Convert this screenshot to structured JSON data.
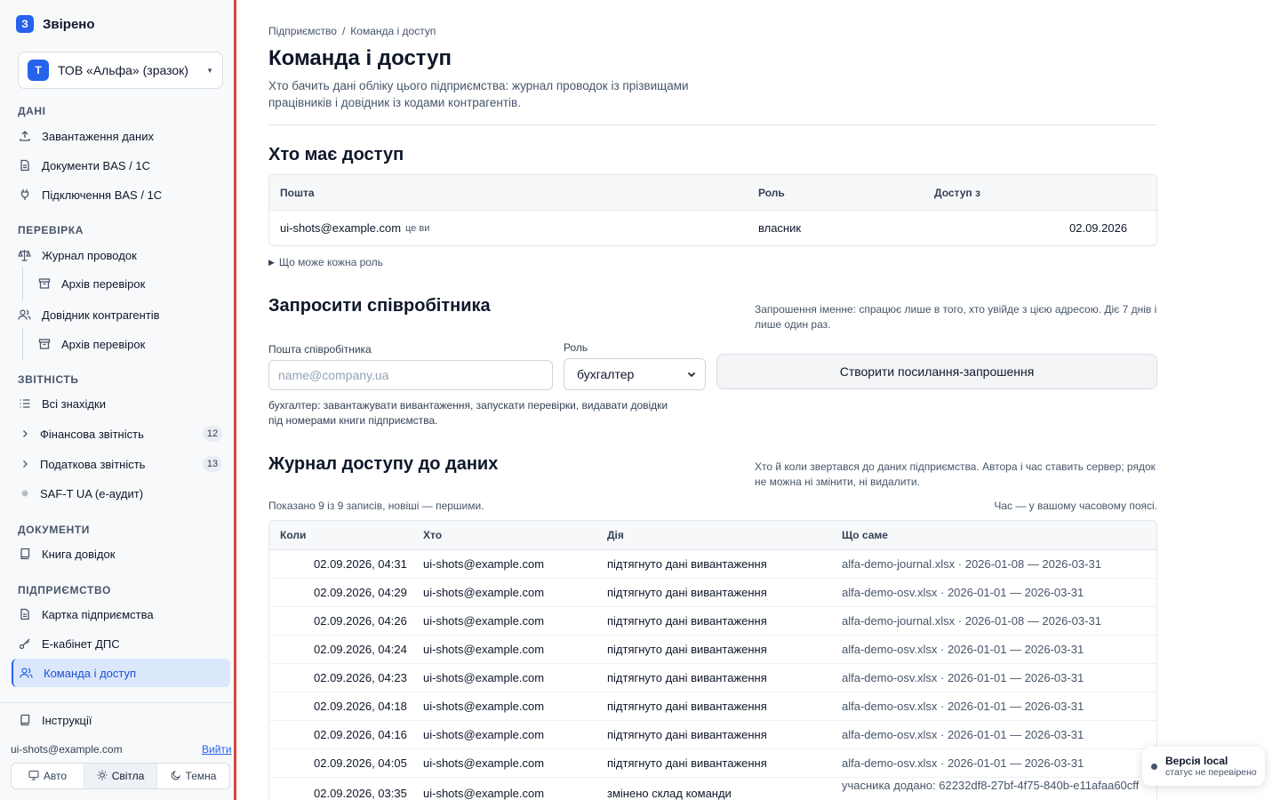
{
  "app": {
    "logo_letter": "З",
    "name": "Звірено"
  },
  "org": {
    "avatar_letter": "Т",
    "name": "ТОВ «Альфа» (зразок)"
  },
  "sidebar": {
    "sections": {
      "data": "ДАНІ",
      "check": "ПЕРЕВІРКА",
      "reports": "ЗВІТНІСТЬ",
      "documents": "ДОКУМЕНТИ",
      "company": "ПІДПРИЄМСТВО"
    },
    "items": {
      "upload": "Завантаження даних",
      "bas_docs": "Документи BAS / 1С",
      "bas_connect": "Підключення BAS / 1С",
      "journal": "Журнал проводок",
      "journal_archive": "Архів перевірок",
      "counterparties": "Довідник контрагентів",
      "counterparties_archive": "Архів перевірок",
      "all_findings": "Всі знахідки",
      "financial": "Фінансова звітність",
      "financial_count": "12",
      "tax": "Податкова звітність",
      "tax_count": "13",
      "saft": "SAF-T UA (е-аудит)",
      "certificates_book": "Книга довідок",
      "company_card": "Картка підприємства",
      "dps_cabinet": "Е-кабінет ДПС",
      "team_access": "Команда і доступ",
      "instructions": "Інструкції"
    },
    "user_email": "ui-shots@example.com",
    "logout": "Вийти",
    "theme": {
      "auto": "Авто",
      "light": "Світла",
      "dark": "Темна",
      "selected": "light"
    }
  },
  "breadcrumb": {
    "parent": "Підприємство",
    "sep": "/",
    "current": "Команда і доступ"
  },
  "page": {
    "title": "Команда і доступ",
    "subtitle": "Хто бачить дані обліку цього підприємства: журнал проводок із прізвищами працівників і довідник із кодами контрагентів."
  },
  "access": {
    "title": "Хто має доступ",
    "columns": {
      "email": "Пошта",
      "role": "Роль",
      "since": "Доступ з"
    },
    "rows": [
      {
        "email": "ui-shots@example.com",
        "tag": "це ви",
        "role": "власник",
        "since": "02.09.2026"
      }
    ],
    "roles_toggle": "Що може кожна роль"
  },
  "invite": {
    "title": "Запросити співробітника",
    "note": "Запрошення іменне: спрацює лише в того, хто увійде з цією адресою. Діє 7 днів і лише один раз.",
    "email_label": "Пошта співробітника",
    "email_placeholder": "name@company.ua",
    "email_value": "",
    "role_label": "Роль",
    "role_value": "бухгалтер",
    "submit": "Створити посилання-запрошення",
    "role_help": "бухгалтер: завантажувати вивантаження, запускати перевірки, видавати довідки під номерами книги підприємства."
  },
  "log": {
    "title": "Журнал доступу до даних",
    "note": "Хто й коли звертався до даних підприємства. Автора і час ставить сервер; рядок не можна ні змінити, ні видалити.",
    "shown": "Показано 9 із 9 записів, новіші — першими.",
    "tz_note": "Час — у вашому часовому поясі.",
    "columns": {
      "when": "Коли",
      "who": "Хто",
      "action": "Дія",
      "what": "Що саме"
    },
    "rows": [
      {
        "when": "02.09.2026, 04:31",
        "who": "ui-shots@example.com",
        "action": "підтягнуто дані вивантаження",
        "what": "alfa-demo-journal.xlsx · 2026-01-08 — 2026-03-31"
      },
      {
        "when": "02.09.2026, 04:29",
        "who": "ui-shots@example.com",
        "action": "підтягнуто дані вивантаження",
        "what": "alfa-demo-osv.xlsx · 2026-01-01 — 2026-03-31"
      },
      {
        "when": "02.09.2026, 04:26",
        "who": "ui-shots@example.com",
        "action": "підтягнуто дані вивантаження",
        "what": "alfa-demo-journal.xlsx · 2026-01-08 — 2026-03-31"
      },
      {
        "when": "02.09.2026, 04:24",
        "who": "ui-shots@example.com",
        "action": "підтягнуто дані вивантаження",
        "what": "alfa-demo-osv.xlsx · 2026-01-01 — 2026-03-31"
      },
      {
        "when": "02.09.2026, 04:23",
        "who": "ui-shots@example.com",
        "action": "підтягнуто дані вивантаження",
        "what": "alfa-demo-osv.xlsx · 2026-01-01 — 2026-03-31"
      },
      {
        "when": "02.09.2026, 04:18",
        "who": "ui-shots@example.com",
        "action": "підтягнуто дані вивантаження",
        "what": "alfa-demo-osv.xlsx · 2026-01-01 — 2026-03-31"
      },
      {
        "when": "02.09.2026, 04:16",
        "who": "ui-shots@example.com",
        "action": "підтягнуто дані вивантаження",
        "what": "alfa-demo-osv.xlsx · 2026-01-01 — 2026-03-31"
      },
      {
        "when": "02.09.2026, 04:05",
        "who": "ui-shots@example.com",
        "action": "підтягнуто дані вивантаження",
        "what": "alfa-demo-osv.xlsx · 2026-01-01 — 2026-03-31"
      },
      {
        "when": "02.09.2026, 03:35",
        "who": "ui-shots@example.com",
        "action": "змінено склад команди",
        "what": "учасника додано: 62232df8-27bf-4f75-840b-e11afaa60cff"
      }
    ]
  },
  "toast": {
    "title": "Версія local",
    "status": "статус не перевірено"
  },
  "colors": {
    "accent": "#2563eb",
    "active_bg": "#dbe8fb",
    "sidebar_border": "#d04a3a"
  }
}
